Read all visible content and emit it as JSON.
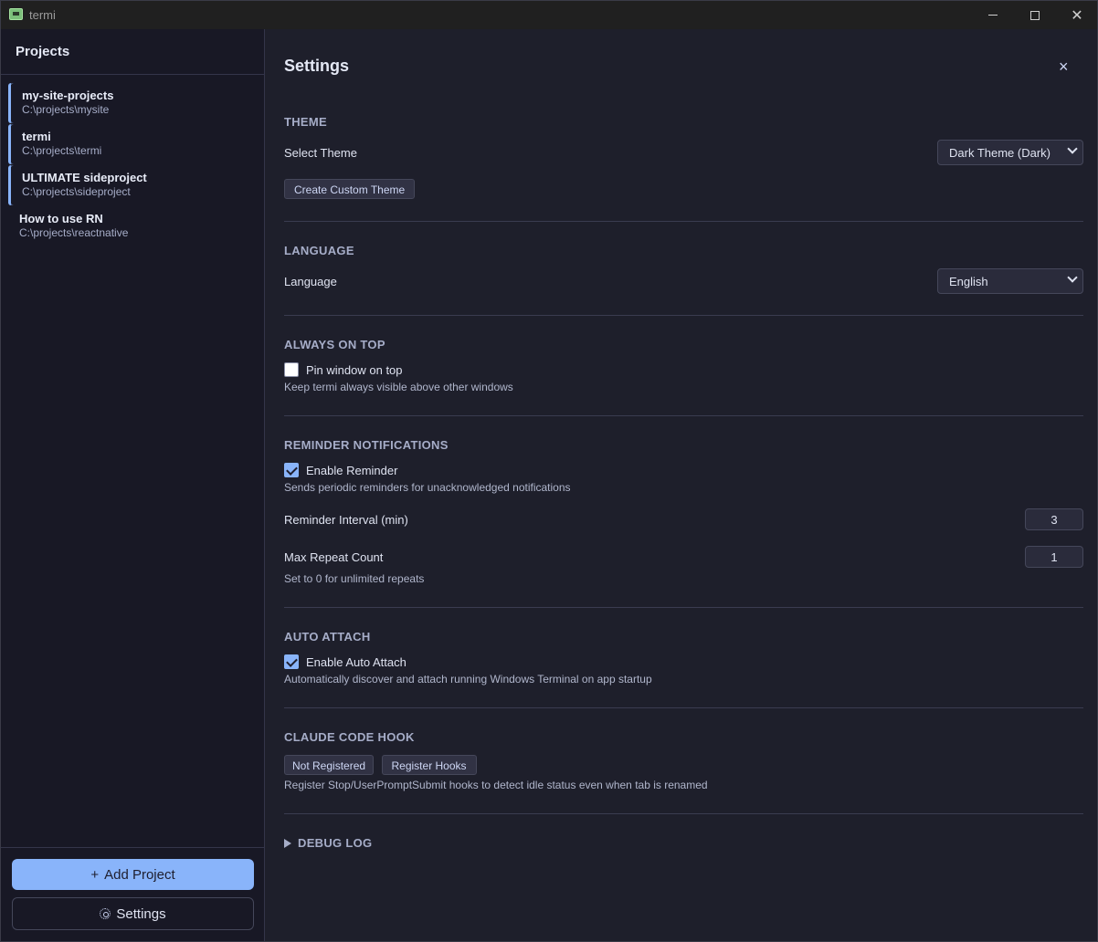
{
  "window": {
    "title": "termi"
  },
  "sidebar": {
    "header": "Projects",
    "projects": [
      {
        "name": "my-site-projects",
        "path": "C:\\projects\\mysite"
      },
      {
        "name": "termi",
        "path": "C:\\projects\\termi"
      },
      {
        "name": "ULTIMATE sideproject",
        "path": "C:\\projects\\sideproject"
      },
      {
        "name": "How to use RN",
        "path": "C:\\projects\\reactnative"
      }
    ],
    "add_project": "Add Project",
    "add_icon": "+",
    "settings": "Settings"
  },
  "settings": {
    "title": "Settings",
    "close": "×",
    "theme": {
      "title": "THEME",
      "label": "Select Theme",
      "value": "Dark Theme (Dark)",
      "create_button": "Create Custom Theme"
    },
    "language": {
      "title": "LANGUAGE",
      "label": "Language",
      "value": "English"
    },
    "always_on_top": {
      "title": "ALWAYS ON TOP",
      "checkbox_label": "Pin window on top",
      "checked": false,
      "hint": "Keep termi always visible above other windows"
    },
    "reminder": {
      "title": "REMINDER NOTIFICATIONS",
      "checkbox_label": "Enable Reminder",
      "checked": true,
      "hint": "Sends periodic reminders for unacknowledged notifications",
      "interval_label": "Reminder Interval (min)",
      "interval_value": "3",
      "max_repeat_label": "Max Repeat Count",
      "max_repeat_value": "1",
      "max_repeat_hint": "Set to 0 for unlimited repeats"
    },
    "auto_attach": {
      "title": "AUTO ATTACH",
      "checkbox_label": "Enable Auto Attach",
      "checked": true,
      "hint": "Automatically discover and attach running Windows Terminal on app startup"
    },
    "claude_hook": {
      "title": "CLAUDE CODE HOOK",
      "status": "Not Registered",
      "register_button": "Register Hooks",
      "hint": "Register Stop/UserPromptSubmit hooks to detect idle status even when tab is renamed"
    },
    "debug_log": {
      "title": "DEBUG LOG"
    }
  },
  "colors": {
    "accent": "#89b4fa",
    "background": "#1e1f2b",
    "sidebar": "#181825"
  }
}
